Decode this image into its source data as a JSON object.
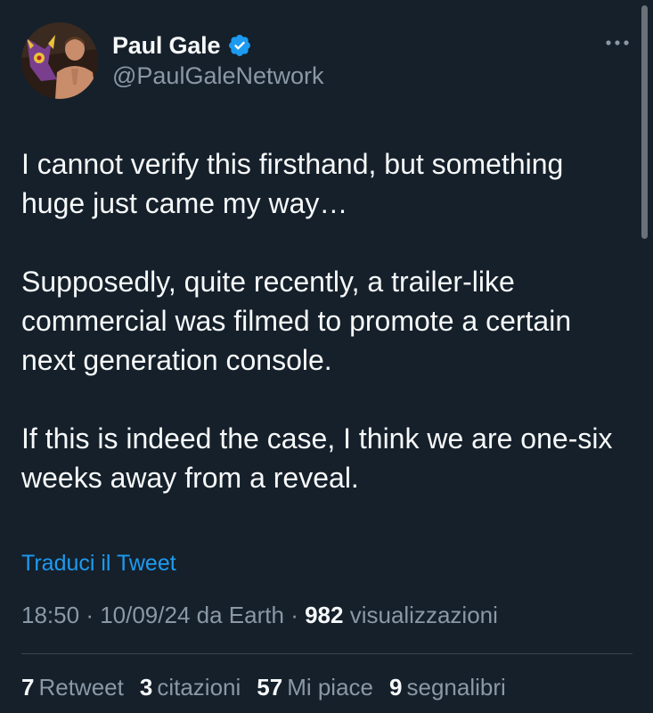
{
  "author": {
    "display_name": "Paul Gale",
    "handle": "@PaulGaleNetwork",
    "verified": true,
    "verified_color": "#1d9bf0",
    "avatar_icon": "avatar-photo"
  },
  "tweet": {
    "paragraphs": [
      "I cannot verify this firsthand, but something huge just came my way…",
      "Supposedly, quite recently, a trailer-like commercial was filmed to promote a certain next generation console.",
      "If this is indeed the case, I think we are one-six weeks away from a reveal."
    ],
    "translate_label": "Traduci il Tweet"
  },
  "meta": {
    "time": "18:50",
    "date": "10/09/24",
    "source": "da Earth",
    "views_count": "982",
    "views_label": "visualizzazioni"
  },
  "stats": [
    {
      "count": "7",
      "label": "Retweet"
    },
    {
      "count": "3",
      "label": "citazioni"
    },
    {
      "count": "57",
      "label": "Mi piace"
    },
    {
      "count": "9",
      "label": "segnalibri"
    }
  ],
  "colors": {
    "background": "#15202b",
    "text": "#f7f9f9",
    "secondary": "#8b98a5",
    "link": "#1d9bf0",
    "divider": "#38444d"
  }
}
